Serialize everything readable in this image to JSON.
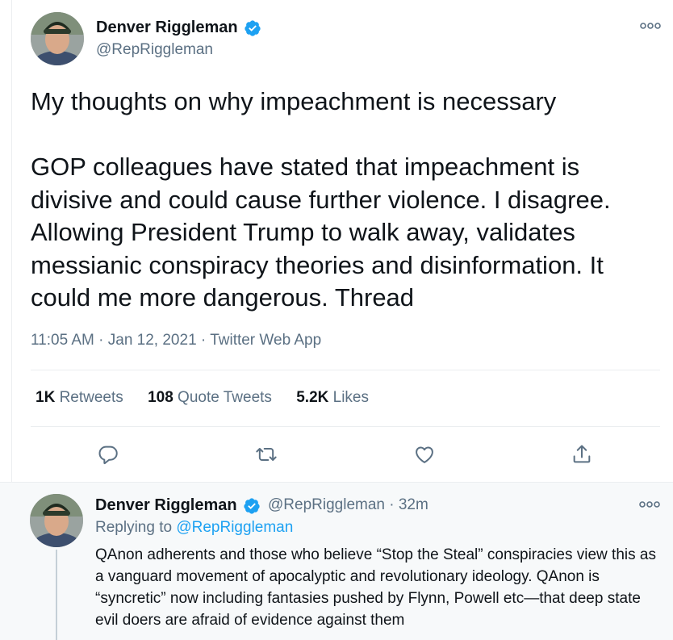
{
  "tweet": {
    "author": {
      "name": "Denver Riggleman",
      "handle": "@RepRiggleman",
      "verified": true
    },
    "text": "My thoughts on why impeachment is necessary\n\nGOP colleagues have stated that impeachment is divisive and could cause further violence. I disagree. Allowing President Trump to walk away, validates messianic conspiracy theories and disinformation. It could me more dangerous. Thread",
    "time": "11:05 AM",
    "date": "Jan 12, 2021",
    "source": "Twitter Web App",
    "separator": " · ",
    "stats": [
      {
        "count": "1K",
        "label": "Retweets"
      },
      {
        "count": "108",
        "label": "Quote Tweets"
      },
      {
        "count": "5.2K",
        "label": "Likes"
      }
    ],
    "actions": [
      "reply-icon",
      "retweet-icon",
      "like-icon",
      "share-icon"
    ]
  },
  "reply": {
    "author": {
      "name": "Denver Riggleman",
      "handle": "@RepRiggleman",
      "time_ago": "32m",
      "verified": true
    },
    "replying_prefix": "Replying to",
    "replying_handle": "@RepRiggleman",
    "text": "QAnon adherents and those who believe “Stop the Steal” conspiracies view this as a vanguard movement of apocalyptic and revolutionary ideology. QAnon is “syncretic” now including fantasies pushed by Flynn, Powell etc—that deep state evil doers are afraid of evidence against them"
  },
  "colors": {
    "text": "#0f1419",
    "secondary": "#5b7083",
    "accent": "#1da1f2",
    "divider": "#ebeef0",
    "reply_bg": "#f7f9fa"
  }
}
